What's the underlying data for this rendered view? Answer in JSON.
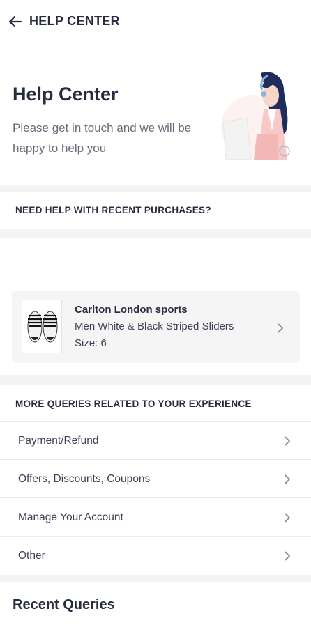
{
  "header": {
    "title": "HELP CENTER",
    "back_icon": "arrow-left-icon"
  },
  "hero": {
    "title": "Help Center",
    "subtitle": "Please get in touch and we will be happy to help you",
    "illustration": "support-agent-illustration"
  },
  "purchases": {
    "heading": "NEED HELP WITH RECENT PURCHASES?",
    "order": {
      "brand": "Carlton London sports",
      "product": "Men White & Black Striped Sliders",
      "size": "Size: 6",
      "chevron_icon": "chevron-right-icon"
    }
  },
  "queries": {
    "heading": "MORE QUERIES RELATED TO YOUR EXPERIENCE",
    "items": [
      {
        "label": "Payment/Refund"
      },
      {
        "label": "Offers, Discounts, Coupons"
      },
      {
        "label": "Manage Your Account"
      },
      {
        "label": "Other"
      }
    ]
  },
  "recent": {
    "title": "Recent Queries"
  },
  "colors": {
    "text_primary": "#282c3f",
    "text_secondary": "#696b79",
    "divider_band": "#f4f4f5",
    "card_bg": "#f5f5f6"
  }
}
